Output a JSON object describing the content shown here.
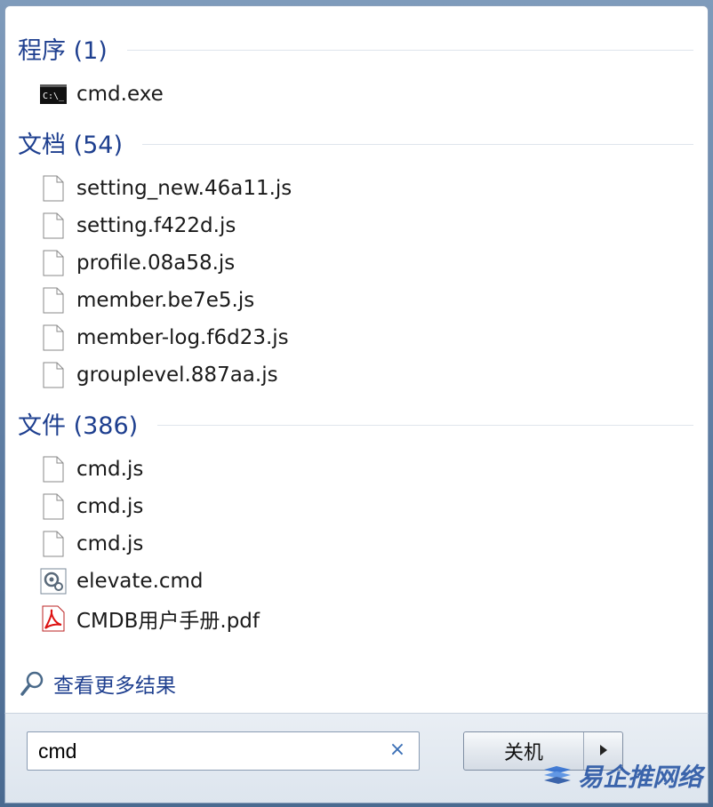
{
  "groups": [
    {
      "title": "程序 (1)",
      "items": [
        {
          "label": "cmd.exe",
          "icon": "cmd-icon"
        }
      ]
    },
    {
      "title": "文档 (54)",
      "items": [
        {
          "label": "setting_new.46a11.js",
          "icon": "file-icon"
        },
        {
          "label": "setting.f422d.js",
          "icon": "file-icon"
        },
        {
          "label": "profile.08a58.js",
          "icon": "file-icon"
        },
        {
          "label": "member.be7e5.js",
          "icon": "file-icon"
        },
        {
          "label": "member-log.f6d23.js",
          "icon": "file-icon"
        },
        {
          "label": "grouplevel.887aa.js",
          "icon": "file-icon"
        }
      ]
    },
    {
      "title": "文件 (386)",
      "items": [
        {
          "label": "cmd.js",
          "icon": "file-icon"
        },
        {
          "label": "cmd.js",
          "icon": "file-icon"
        },
        {
          "label": "cmd.js",
          "icon": "file-icon"
        },
        {
          "label": "elevate.cmd",
          "icon": "gear-file-icon"
        },
        {
          "label": "CMDB用户手册.pdf",
          "icon": "pdf-icon"
        }
      ]
    }
  ],
  "see_more": {
    "label": "查看更多结果",
    "icon": "search-icon"
  },
  "search": {
    "value": "cmd",
    "clear_icon": "close-icon"
  },
  "shutdown": {
    "label": "关机",
    "arrow_icon": "triangle-right-icon"
  },
  "watermark": {
    "text": "易企推网络"
  },
  "colors": {
    "group_title": "#1e3f8f",
    "frame": "#5b7aa0"
  }
}
